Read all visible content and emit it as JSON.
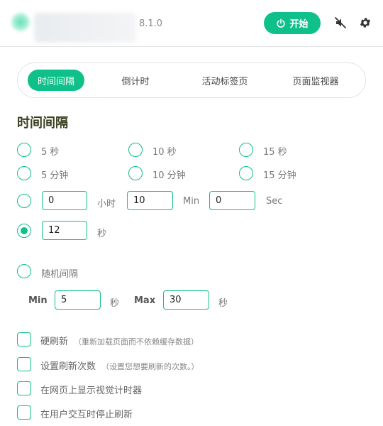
{
  "header": {
    "version": "8.1.0",
    "start_label": "开始"
  },
  "tabs": [
    {
      "label": "时间间隔",
      "active": true
    },
    {
      "label": "倒计时",
      "active": false
    },
    {
      "label": "活动标签页",
      "active": false
    },
    {
      "label": "页面监视器",
      "active": false
    }
  ],
  "interval": {
    "title": "时间间隔",
    "presets": [
      {
        "label": "5 秒"
      },
      {
        "label": "10 秒"
      },
      {
        "label": "15 秒"
      },
      {
        "label": "5 分钟"
      },
      {
        "label": "10 分钟"
      },
      {
        "label": "15 分钟"
      }
    ],
    "custom": {
      "hours_value": "0",
      "hours_unit": "小时",
      "minutes_value": "10",
      "minutes_unit": "Min",
      "seconds_value": "0",
      "seconds_unit": "Sec"
    },
    "seconds_option": {
      "value": "12",
      "unit": "秒",
      "selected": true
    },
    "random": {
      "label": "随机间隔",
      "min_label": "Min",
      "min_value": "5",
      "min_unit": "秒",
      "max_label": "Max",
      "max_value": "30",
      "max_unit": "秒"
    }
  },
  "options": [
    {
      "label": "硬刷新",
      "hint": "（重新加载页面而不依赖缓存数据）"
    },
    {
      "label": "设置刷新次数",
      "hint": "（设置您想要刷新的次数。）"
    },
    {
      "label": "在网页上显示视觉计时器",
      "hint": ""
    },
    {
      "label": "在用户交互时停止刷新",
      "hint": ""
    }
  ],
  "colors": {
    "accent": "#10c08a",
    "title": "#3b3f1f"
  },
  "icons": {
    "start": "power-icon",
    "mute": "speaker-muted-icon",
    "settings": "gear-icon"
  }
}
